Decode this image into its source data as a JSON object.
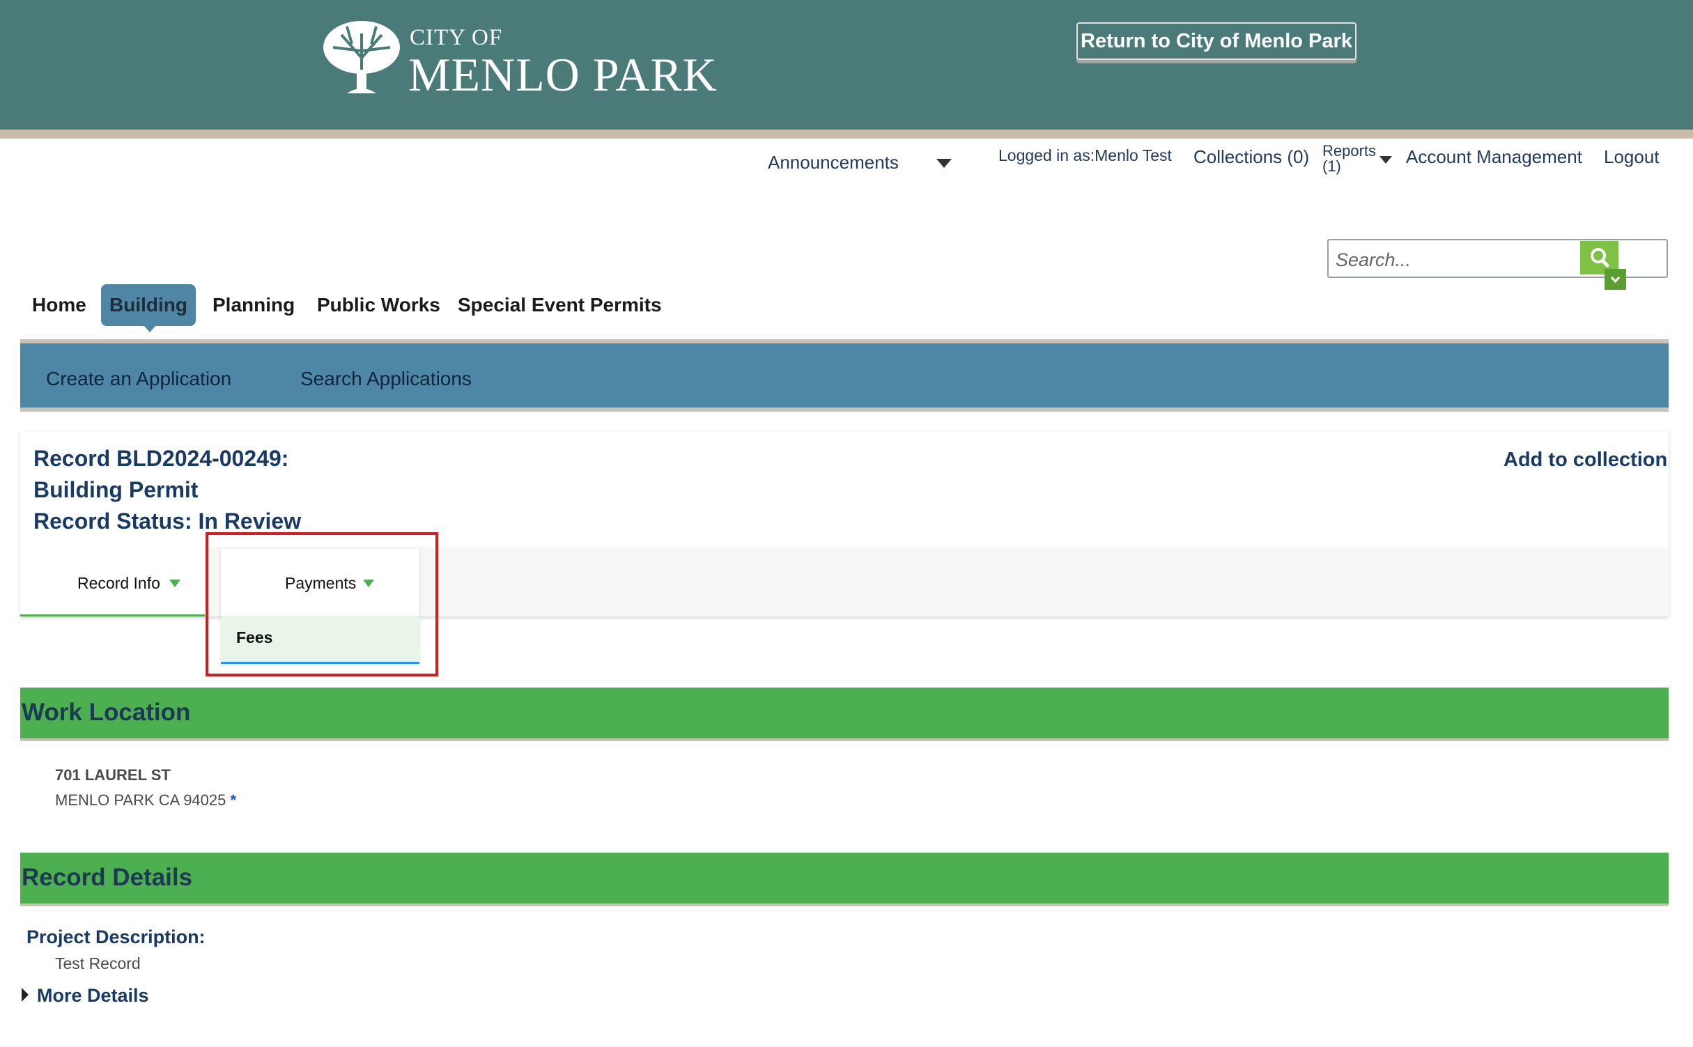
{
  "header": {
    "logo_city_of": "CITY OF",
    "logo_name": "MENLO PARK",
    "return_button": "Return to City of Menlo Park"
  },
  "topnav": {
    "announcements": "Announcements",
    "logged_in": "Logged in as:Menlo Test",
    "collections": "Collections (0)",
    "reports": "Reports",
    "reports_count": "(1)",
    "account": "Account Management",
    "logout": "Logout"
  },
  "search": {
    "placeholder": "Search..."
  },
  "main_tabs": [
    "Home",
    "Building",
    "Planning",
    "Public Works",
    "Special Event Permits"
  ],
  "subnav": {
    "create": "Create an Application",
    "search": "Search Applications"
  },
  "record": {
    "number_line": "Record BLD2024-00249:",
    "type_line": "Building Permit",
    "status_line": "Record Status: In Review",
    "add_to_collection": "Add to collection",
    "tabs": {
      "record_info": "Record Info",
      "payments": "Payments"
    },
    "payments_menu": [
      "Fees"
    ]
  },
  "work_location": {
    "title": "Work Location",
    "address_line1": "701 LAUREL ST",
    "address_line2": "MENLO PARK CA 94025",
    "primary_marker": "*"
  },
  "record_details": {
    "title": "Record Details",
    "project_description_label": "Project Description:",
    "project_description_value": "Test Record",
    "more_details": "More Details"
  },
  "colors": {
    "header_bg": "#4a7b79",
    "subnav_bg": "#4e86a6",
    "section_bg": "#4caf50",
    "highlight": "#d71920"
  }
}
